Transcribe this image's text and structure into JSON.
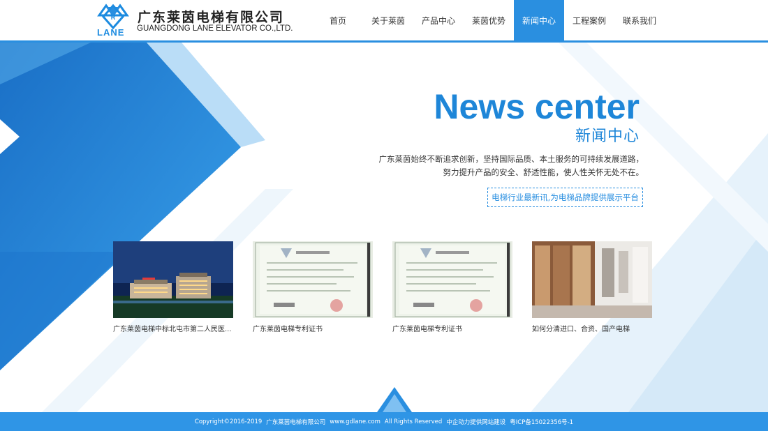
{
  "header": {
    "logo_text": "LANE",
    "logo_letter": "R",
    "company_cn": "广东莱茵电梯有限公司",
    "company_en": "GUANGDONG LANE ELEVATOR CO.,LTD."
  },
  "nav": {
    "items": [
      {
        "label": "首页"
      },
      {
        "label": "关于莱茵"
      },
      {
        "label": "产品中心"
      },
      {
        "label": "莱茵优势"
      },
      {
        "label": "新闻中心",
        "active": true
      },
      {
        "label": "工程案例"
      },
      {
        "label": "联系我们"
      }
    ]
  },
  "hero": {
    "title_en": "News center",
    "title_cn": "新闻中心",
    "desc_line1": "广东莱茵始终不断追求创新，坚持国际品质、本土服务的可持续发展道路，",
    "desc_line2": "努力提升产品的安全、舒适性能，使人性关怀无处不在。",
    "tagline": "电梯行业最新讯,为电梯品牌提供展示平台"
  },
  "news": [
    {
      "title": "广东莱茵电梯中标北屯市第二人民医..."
    },
    {
      "title": "广东莱茵电梯专利证书"
    },
    {
      "title": "广东莱茵电梯专利证书"
    },
    {
      "title": "如何分清进口、合资、国产电梯"
    }
  ],
  "footer": {
    "copyright": "Copyright©2016-2019",
    "company": "广东莱茵电梯有限公司",
    "site": "www.gdlane.com",
    "rights": "All Rights Reserved",
    "builder": "中企动力提供网站建设",
    "icp": "粤ICP备15022356号-1"
  },
  "colors": {
    "brand_blue": "#2a8fe0",
    "title_blue": "#1e86d8",
    "footer_blue": "#2f95e6"
  }
}
